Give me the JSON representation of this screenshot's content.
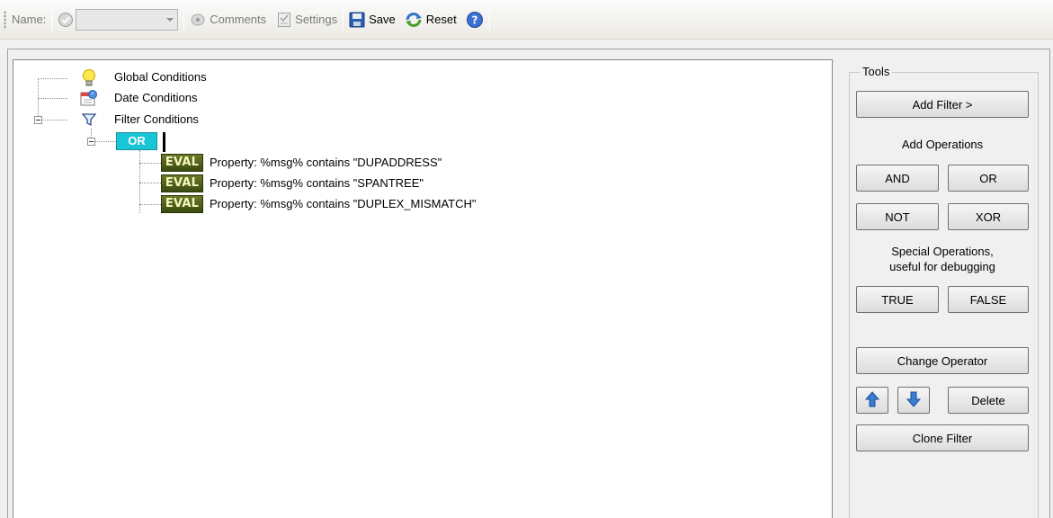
{
  "toolbar": {
    "name_label": "Name:",
    "comments_label": "Comments",
    "settings_label": "Settings",
    "save_label": "Save",
    "reset_label": "Reset"
  },
  "tree": {
    "global_conditions": "Global Conditions",
    "date_conditions": "Date Conditions",
    "filter_conditions": "Filter Conditions",
    "operator": "OR",
    "eval_badge": "EVAL",
    "evals": [
      "Property: %msg% contains \"DUPADDRESS\"",
      "Property: %msg% contains \"SPANTREE\"",
      "Property: %msg% contains \"DUPLEX_MISMATCH\""
    ]
  },
  "tools": {
    "title": "Tools",
    "add_filter": "Add Filter >",
    "add_operations": "Add Operations",
    "and": "AND",
    "or": "OR",
    "not": "NOT",
    "xor": "XOR",
    "special_ops_line1": "Special Operations,",
    "special_ops_line2": "useful for debugging",
    "true": "TRUE",
    "false": "FALSE",
    "change_operator": "Change Operator",
    "delete": "Delete",
    "clone_filter": "Clone Filter"
  },
  "icons": {
    "check": "check-circle-icon",
    "comments": "comments-icon",
    "settings": "settings-icon",
    "save": "floppy-disk-icon",
    "reset": "reset-icon",
    "help": "help-icon",
    "bulb": "lightbulb-icon",
    "calendar": "calendar-icon",
    "funnel": "funnel-icon",
    "up": "arrow-up-icon",
    "down": "arrow-down-icon"
  }
}
